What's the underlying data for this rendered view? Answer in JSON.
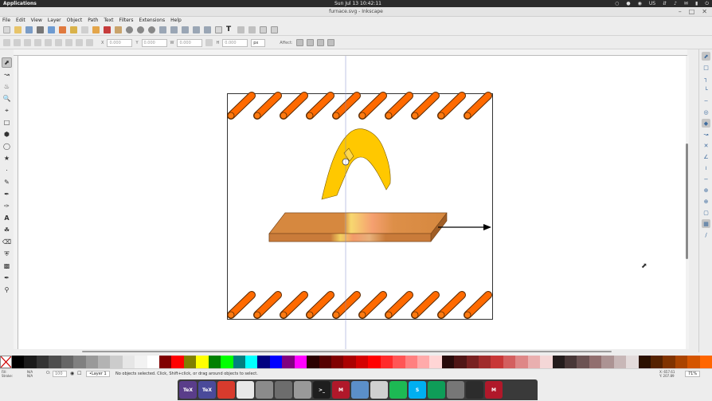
{
  "system": {
    "applications_label": "Applications",
    "clock": "Sun Jul 13 10:42:11",
    "keyboard_layout": "US"
  },
  "window": {
    "title": "furnace.svg - Inkscape"
  },
  "menu": [
    "File",
    "Edit",
    "View",
    "Layer",
    "Object",
    "Path",
    "Text",
    "Filters",
    "Extensions",
    "Help"
  ],
  "toolbar": {
    "x_value": "0.000",
    "y_value": "0.000",
    "w_value": "0.000",
    "h_value": "0.000",
    "unit": "px",
    "affect_label": "Affect:"
  },
  "status": {
    "fill_label": "Fill:",
    "stroke_label": "Stroke:",
    "fill_value": "N/A",
    "stroke_value": "N/A",
    "opacity_value": "100",
    "layer": "•Layer 1",
    "message": "No objects selected. Click, Shift+click, or drag around objects to select.",
    "x_label": "X:",
    "x_coord": "657.61",
    "y_label": "Y:",
    "y_coord": "207.89",
    "zoom": "71%"
  },
  "dock": [
    {
      "name": "texmaker",
      "label": "TeX",
      "color": "#5a3d8a"
    },
    {
      "name": "texstudio",
      "label": "TeX",
      "color": "#4a4a9a"
    },
    {
      "name": "chrome",
      "label": "",
      "color": "#d83b2d"
    },
    {
      "name": "messaging",
      "label": "",
      "color": "#e8e8e8"
    },
    {
      "name": "files",
      "label": "",
      "color": "#8b8b8b"
    },
    {
      "name": "apps",
      "label": "",
      "color": "#6d6d6d"
    },
    {
      "name": "trash",
      "label": "",
      "color": "#999999"
    },
    {
      "name": "terminal",
      "label": ">_",
      "color": "#1e1e1e"
    },
    {
      "name": "mendeley",
      "label": "M",
      "color": "#b0182a"
    },
    {
      "name": "document-viewer",
      "label": "",
      "color": "#5b8fc8"
    },
    {
      "name": "image-viewer",
      "label": "",
      "color": "#d0d0d0"
    },
    {
      "name": "spotify",
      "label": "",
      "color": "#1db954"
    },
    {
      "name": "skype",
      "label": "S",
      "color": "#00aff0"
    },
    {
      "name": "hangouts",
      "label": "",
      "color": "#0f9d58"
    },
    {
      "name": "settings",
      "label": "",
      "color": "#777777"
    },
    {
      "name": "inkscape",
      "label": "",
      "color": "#2c2c2c"
    },
    {
      "name": "mendeley-2",
      "label": "M",
      "color": "#b0182a"
    }
  ],
  "palette": [
    "#000000",
    "#1a1a1a",
    "#333333",
    "#4d4d4d",
    "#666666",
    "#808080",
    "#999999",
    "#b3b3b3",
    "#cccccc",
    "#e6e6e6",
    "#f2f2f2",
    "#ffffff",
    "#800000",
    "#ff0000",
    "#808000",
    "#ffff00",
    "#008000",
    "#00ff00",
    "#008080",
    "#00ffff",
    "#000080",
    "#0000ff",
    "#800080",
    "#ff00ff",
    "#2b0000",
    "#550000",
    "#800000",
    "#aa0000",
    "#d40000",
    "#ff0000",
    "#ff2a2a",
    "#ff5555",
    "#ff8080",
    "#ffaaaa",
    "#ffd5d5",
    "#280b0b",
    "#501616",
    "#782121",
    "#a02c2c",
    "#c83737",
    "#d35f5f",
    "#de8787",
    "#e9afaf",
    "#f4d7d7",
    "#241c1c",
    "#483737",
    "#6c5353",
    "#916f6f",
    "#ac9393",
    "#c8b7b7",
    "#e3dbdb",
    "#2b1100",
    "#552200",
    "#803300",
    "#aa4400",
    "#d45500",
    "#ff6600"
  ]
}
